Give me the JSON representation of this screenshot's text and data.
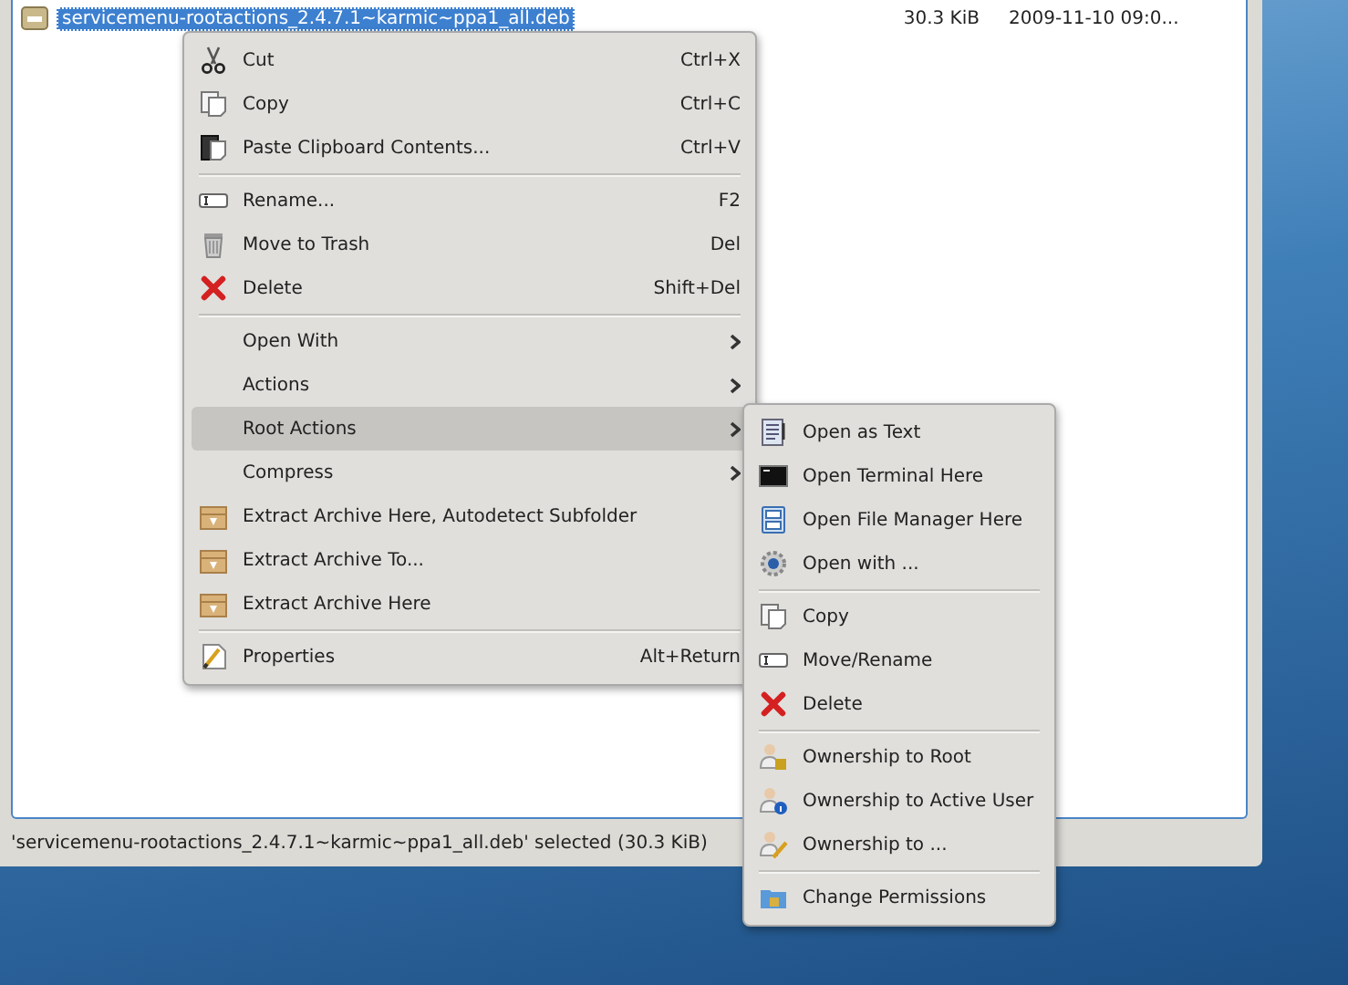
{
  "file_list": {
    "rows": [
      {
        "name": "servicemenu-rootactions_2.4.7.1~karmic~ppa1_all.deb",
        "size": "30.3 KiB",
        "date": "2009-11-10 09:0...",
        "selected": true
      }
    ]
  },
  "status_bar": {
    "text": "'servicemenu-rootactions_2.4.7.1~karmic~ppa1_all.deb' selected (30.3 KiB)"
  },
  "context_menu": {
    "items": [
      {
        "kind": "action",
        "label": "Cut",
        "shortcut": "Ctrl+X",
        "selected": false
      },
      {
        "kind": "action",
        "label": "Copy",
        "shortcut": "Ctrl+C",
        "selected": false
      },
      {
        "kind": "action",
        "label": "Paste Clipboard Contents...",
        "shortcut": "Ctrl+V",
        "selected": false
      },
      {
        "kind": "separator"
      },
      {
        "kind": "action",
        "label": "Rename...",
        "shortcut": "F2",
        "selected": false
      },
      {
        "kind": "action",
        "label": "Move to Trash",
        "shortcut": "Del",
        "selected": false
      },
      {
        "kind": "action",
        "label": "Delete",
        "shortcut": "Shift+Del",
        "selected": false
      },
      {
        "kind": "separator"
      },
      {
        "kind": "submenu",
        "label": "Open With",
        "selected": false
      },
      {
        "kind": "submenu",
        "label": "Actions",
        "selected": false
      },
      {
        "kind": "submenu",
        "label": "Root Actions",
        "selected": true
      },
      {
        "kind": "submenu",
        "label": "Compress",
        "selected": false
      },
      {
        "kind": "action",
        "label": "Extract Archive Here, Autodetect Subfolder",
        "selected": false
      },
      {
        "kind": "action",
        "label": "Extract Archive To...",
        "selected": false
      },
      {
        "kind": "action",
        "label": "Extract Archive Here",
        "selected": false
      },
      {
        "kind": "separator"
      },
      {
        "kind": "action",
        "label": "Properties",
        "shortcut": "Alt+Return",
        "selected": false
      }
    ]
  },
  "submenu": {
    "items": [
      {
        "kind": "action",
        "label": "Open as Text",
        "selected": false
      },
      {
        "kind": "action",
        "label": "Open Terminal Here",
        "selected": false
      },
      {
        "kind": "action",
        "label": "Open File Manager Here",
        "selected": false
      },
      {
        "kind": "action",
        "label": "Open with ...",
        "selected": false
      },
      {
        "kind": "separator"
      },
      {
        "kind": "action",
        "label": "Copy",
        "selected": false
      },
      {
        "kind": "action",
        "label": "Move/Rename",
        "selected": false
      },
      {
        "kind": "action",
        "label": "Delete",
        "selected": false
      },
      {
        "kind": "separator"
      },
      {
        "kind": "action",
        "label": "Ownership to Root",
        "selected": false
      },
      {
        "kind": "action",
        "label": "Ownership to Active User",
        "selected": false
      },
      {
        "kind": "action",
        "label": "Ownership to ...",
        "selected": false
      },
      {
        "kind": "separator"
      },
      {
        "kind": "action",
        "label": "Change Permissions",
        "selected": false
      }
    ]
  }
}
